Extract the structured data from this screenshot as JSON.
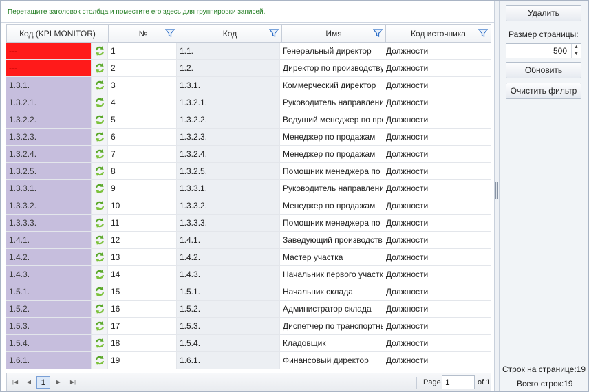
{
  "group_hint": "Перетащите заголовок столбца и поместите его здесь для группировки записей.",
  "columns": {
    "kpi": "Код (KPI MONITOR)",
    "num": "№",
    "code": "Код",
    "name": "Имя",
    "source": "Код источника"
  },
  "rows": [
    {
      "kpi": "---",
      "num": "1",
      "code": "1.1.",
      "name": "Генеральный директор",
      "source": "Должности",
      "highlight": true
    },
    {
      "kpi": "---",
      "num": "2",
      "code": "1.2.",
      "name": "Директор по производству",
      "source": "Должности",
      "highlight": true
    },
    {
      "kpi": "1.3.1.",
      "num": "3",
      "code": "1.3.1.",
      "name": "Коммерческий директор",
      "source": "Должности"
    },
    {
      "kpi": "1.3.2.1.",
      "num": "4",
      "code": "1.3.2.1.",
      "name": "Руководитель направления",
      "source": "Должности"
    },
    {
      "kpi": "1.3.2.2.",
      "num": "5",
      "code": "1.3.2.2.",
      "name": "Ведущий менеджер по продажам",
      "source": "Должности"
    },
    {
      "kpi": "1.3.2.3.",
      "num": "6",
      "code": "1.3.2.3.",
      "name": "Менеджер по продажам",
      "source": "Должности"
    },
    {
      "kpi": "1.3.2.4.",
      "num": "7",
      "code": "1.3.2.4.",
      "name": "Менеджер по продажам",
      "source": "Должности"
    },
    {
      "kpi": "1.3.2.5.",
      "num": "8",
      "code": "1.3.2.5.",
      "name": "Помощник менеджера по продажам",
      "source": "Должности"
    },
    {
      "kpi": "1.3.3.1.",
      "num": "9",
      "code": "1.3.3.1.",
      "name": "Руководитель направления",
      "source": "Должности"
    },
    {
      "kpi": "1.3.3.2.",
      "num": "10",
      "code": "1.3.3.2.",
      "name": "Менеджер по продажам",
      "source": "Должности"
    },
    {
      "kpi": "1.3.3.3.",
      "num": "11",
      "code": "1.3.3.3.",
      "name": "Помощник менеджера по продажам",
      "source": "Должности"
    },
    {
      "kpi": "1.4.1.",
      "num": "12",
      "code": "1.4.1.",
      "name": "Заведующий производством",
      "source": "Должности"
    },
    {
      "kpi": "1.4.2.",
      "num": "13",
      "code": "1.4.2.",
      "name": "Мастер участка",
      "source": "Должности"
    },
    {
      "kpi": "1.4.3.",
      "num": "14",
      "code": "1.4.3.",
      "name": "Начальник первого участка",
      "source": "Должности"
    },
    {
      "kpi": "1.5.1.",
      "num": "15",
      "code": "1.5.1.",
      "name": "Начальник склада",
      "source": "Должности"
    },
    {
      "kpi": "1.5.2.",
      "num": "16",
      "code": "1.5.2.",
      "name": "Администратор склада",
      "source": "Должности"
    },
    {
      "kpi": "1.5.3.",
      "num": "17",
      "code": "1.5.3.",
      "name": "Диспетчер по транспортным перевозкам",
      "source": "Должности"
    },
    {
      "kpi": "1.5.4.",
      "num": "18",
      "code": "1.5.4.",
      "name": "Кладовщик",
      "source": "Должности"
    },
    {
      "kpi": "1.6.1.",
      "num": "19",
      "code": "1.6.1.",
      "name": "Финансовый директор",
      "source": "Должности"
    }
  ],
  "pager": {
    "current_page": "1",
    "page_label": "Page",
    "page_input": "1",
    "of_label": "of 1"
  },
  "side": {
    "delete_button": "Удалить",
    "page_size_label": "Размер страницы:",
    "page_size_value": "500",
    "refresh_button": "Обновить",
    "clear_filter_button": "Очистить фильтр",
    "rows_on_page": "Строк на странице:19",
    "total_rows": "Всего строк:19"
  },
  "colors": {
    "highlight_red": "#ff1a1a",
    "kpi_purple": "#c6bedd",
    "code_gray": "#eceff3",
    "hint_green": "#1e7a1e",
    "accent_blue": "#2f6fc7"
  },
  "icons": {
    "filter": "filter-funnel-icon",
    "refresh": "green-refresh-arrows-icon",
    "first": "first-page-icon",
    "prev": "prev-page-icon",
    "next": "next-page-icon",
    "last": "last-page-icon"
  }
}
